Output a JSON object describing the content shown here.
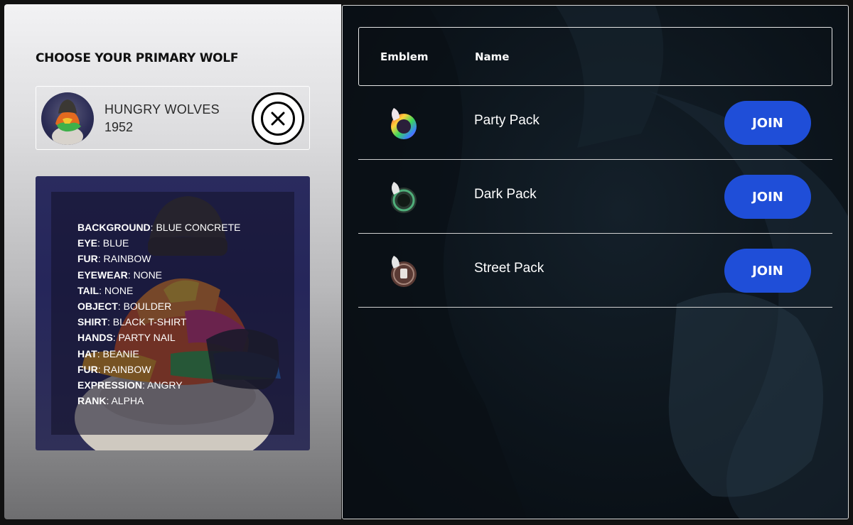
{
  "left_panel": {
    "title": "CHOOSE YOUR PRIMARY WOLF",
    "selected_wolf": {
      "collection": "HUNGRY WOLVES",
      "token_id": "1952",
      "remove_icon": "close-circle-icon"
    },
    "traits": [
      {
        "key": "BACKGROUND",
        "value": ": BLUE CONCRETE"
      },
      {
        "key": "EYE",
        "value": ": BLUE"
      },
      {
        "key": "FUR",
        "value": ": RAINBOW"
      },
      {
        "key": "EYEWEAR",
        "value": ": NONE"
      },
      {
        "key": "TAIL",
        "value": ": NONE"
      },
      {
        "key": "OBJECT",
        "value": ": BOULDER"
      },
      {
        "key": "SHIRT",
        "value": ": BLACK T-SHIRT"
      },
      {
        "key": "HANDS",
        "value": ": PARTY NAIL"
      },
      {
        "key": "HAT",
        "value": ": BEANIE"
      },
      {
        "key": "FUR",
        "value": ": RAINBOW"
      },
      {
        "key": "EXPRESSION",
        "value": ": ANGRY"
      },
      {
        "key": "RANK",
        "value": ": ALPHA"
      }
    ]
  },
  "packs_table": {
    "headers": {
      "emblem": "Emblem",
      "name": "Name"
    },
    "rows": [
      {
        "name": "Party Pack",
        "join_label": "JOIN",
        "emblem_icon": "rainbow-wolf-emblem-icon",
        "emblem_color": "#d63ad0"
      },
      {
        "name": "Dark Pack",
        "join_label": "JOIN",
        "emblem_icon": "dark-wolf-emblem-icon",
        "emblem_color": "#3d8a62"
      },
      {
        "name": "Street Pack",
        "join_label": "JOIN",
        "emblem_icon": "street-wolf-emblem-icon",
        "emblem_color": "#6a4a42"
      }
    ]
  },
  "colors": {
    "accent": "#1f4ed8",
    "left_panel_top": "#f2f2f4",
    "right_panel_bg": "#0c141b"
  }
}
